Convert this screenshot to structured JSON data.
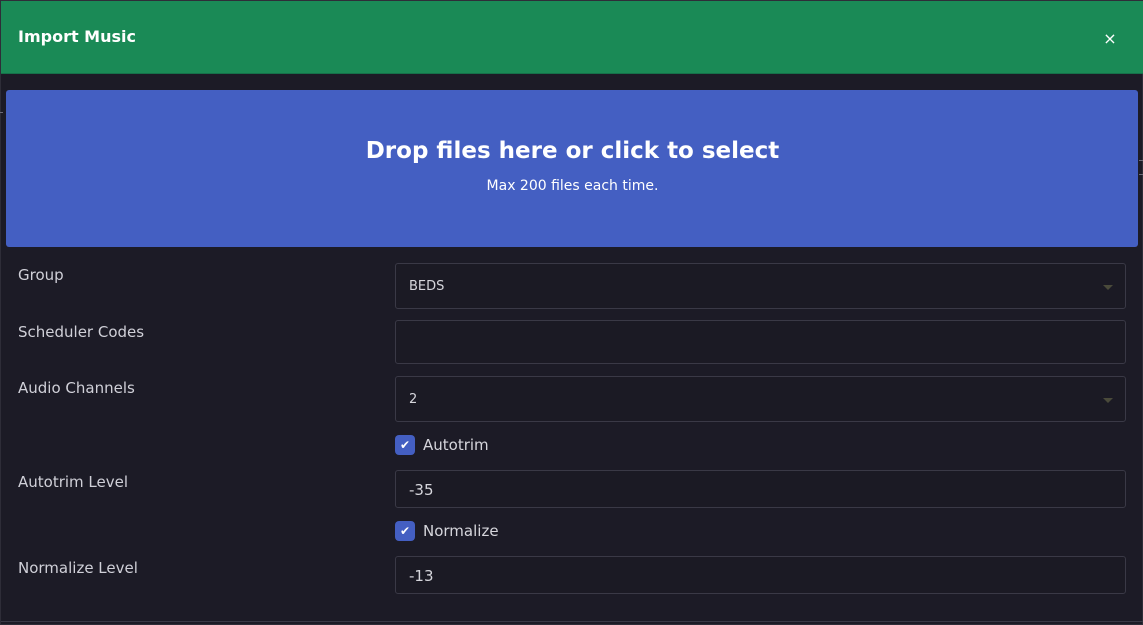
{
  "header": {
    "title": "Import Music",
    "close_icon": "×"
  },
  "dropzone": {
    "title": "Drop files here or click to select",
    "subtitle": "Max 200 files each time."
  },
  "form": {
    "group": {
      "label": "Group",
      "value": "BEDS"
    },
    "scheduler_codes": {
      "label": "Scheduler Codes",
      "value": ""
    },
    "audio_channels": {
      "label": "Audio Channels",
      "value": "2"
    },
    "autotrim": {
      "label": "Autotrim",
      "checked": true,
      "check_glyph": "✔"
    },
    "autotrim_level": {
      "label": "Autotrim Level",
      "value": "-35"
    },
    "normalize": {
      "label": "Normalize",
      "checked": true,
      "check_glyph": "✔"
    },
    "normalize_level": {
      "label": "Normalize Level",
      "value": "-13"
    }
  },
  "colors": {
    "header_bg": "#1a8a56",
    "dropzone_bg": "#445fc2",
    "checkbox_bg": "#445fc2",
    "body_bg": "#1c1b26"
  }
}
